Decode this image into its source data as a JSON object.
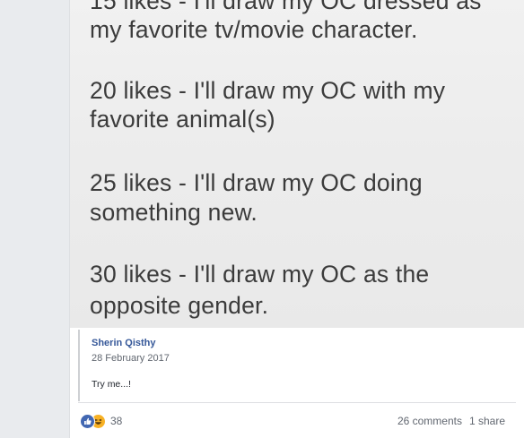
{
  "post_image": {
    "lines": [
      "15 likes - I'll draw my OC dressed as",
      "my favorite tv/movie character.",
      "20 likes - I'll draw my OC with my",
      "favorite animal(s)",
      "25 likes - I'll draw my OC doing",
      "something new.",
      "30 likes - I'll draw my OC as the",
      "opposite gender."
    ]
  },
  "caption": {
    "author": "Sherin Qisthy",
    "date": "28 February 2017",
    "text": "Try me...!"
  },
  "footer": {
    "reaction_count": "38",
    "comments": "26 comments",
    "shares": "1 share"
  },
  "colors": {
    "link": "#365899",
    "like": "#4267b2",
    "haha": "#f7b125",
    "meta": "#616770"
  },
  "icons": [
    "like-icon",
    "haha-icon"
  ]
}
